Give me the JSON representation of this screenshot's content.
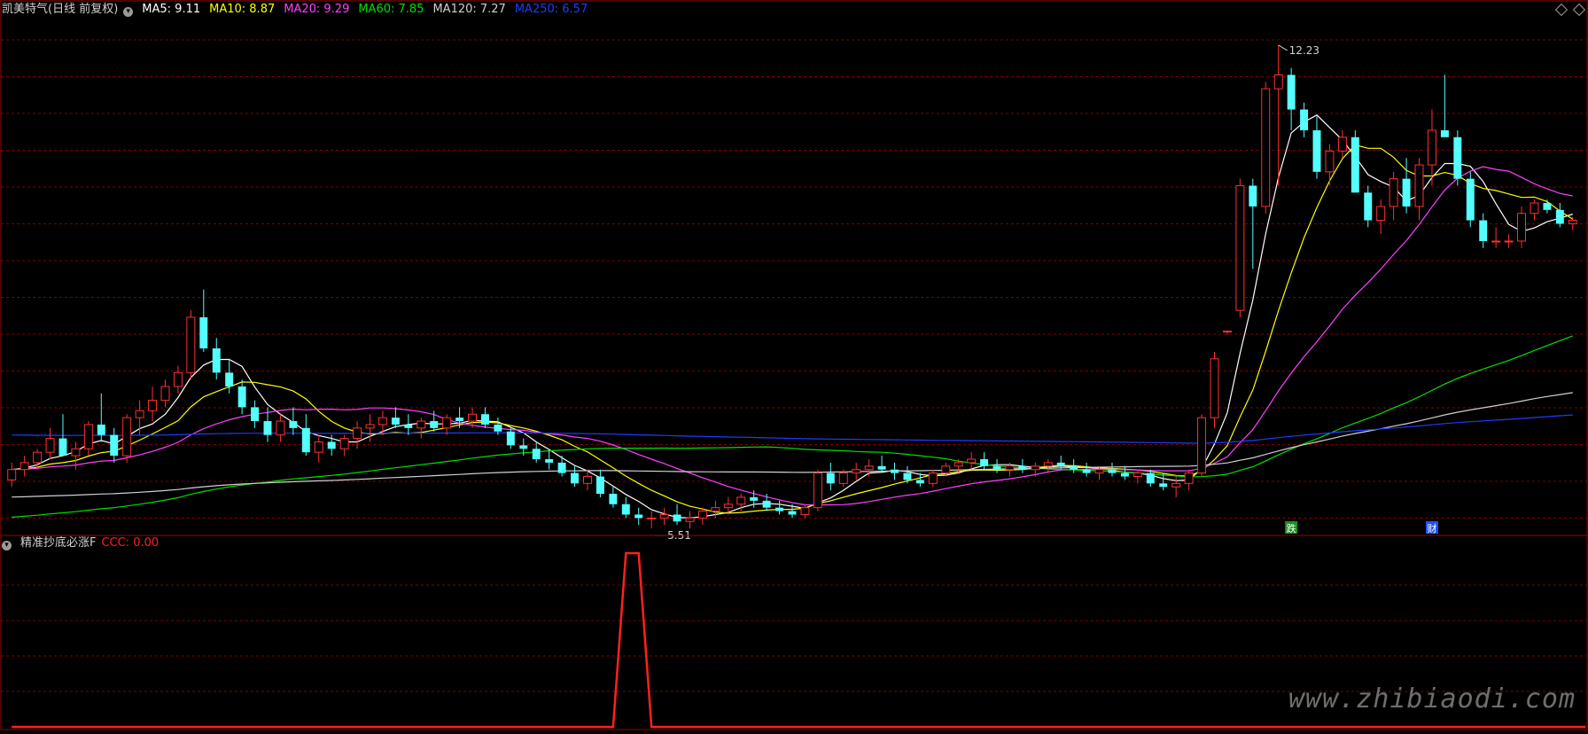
{
  "main_panel": {
    "stock_title": "凯美特气(日线 前复权)",
    "ma_legend": [
      {
        "label": "MA5: 9.11",
        "color": "#ffffff"
      },
      {
        "label": "MA10: 8.87",
        "color": "#ffff00"
      },
      {
        "label": "MA20: 9.29",
        "color": "#ff40ff"
      },
      {
        "label": "MA60: 7.85",
        "color": "#00e000"
      },
      {
        "label": "MA120: 7.27",
        "color": "#d0d0d0"
      },
      {
        "label": "MA250: 6.57",
        "color": "#1e3cff"
      }
    ],
    "high_annotation": "12.23",
    "low_annotation": "5.51",
    "event_markers": [
      "跌",
      "财"
    ]
  },
  "sub_panel": {
    "indicator_name": "精准抄底必涨F",
    "indicator_value": "CCC: 0.00",
    "indicator_color": "#ff2020"
  },
  "watermark": "www.zhibiaodi.com",
  "colors": {
    "up": "#ff3030",
    "down": "#54ffff",
    "grid": "#800000",
    "border": "#a00000",
    "ma5": "#ffffff",
    "ma10": "#ffff00",
    "ma20": "#ff40ff",
    "ma60": "#00e000",
    "ma120": "#d0d0d0",
    "ma250": "#1e3cff"
  },
  "chart_data": [
    {
      "type": "candlestick",
      "title": "凯美特气(日线 前复权)",
      "ylim": [
        5.2,
        12.6
      ],
      "candles": [
        [
          5.95,
          6.2,
          5.85,
          6.1
        ],
        [
          6.1,
          6.3,
          6.0,
          6.2
        ],
        [
          6.2,
          6.4,
          6.1,
          6.35
        ],
        [
          6.35,
          6.7,
          6.25,
          6.55
        ],
        [
          6.55,
          6.9,
          6.4,
          6.3
        ],
        [
          6.3,
          6.5,
          6.1,
          6.4
        ],
        [
          6.4,
          6.8,
          6.3,
          6.75
        ],
        [
          6.75,
          7.2,
          6.5,
          6.6
        ],
        [
          6.6,
          6.7,
          6.2,
          6.3
        ],
        [
          6.3,
          6.9,
          6.2,
          6.85
        ],
        [
          6.85,
          7.1,
          6.6,
          6.95
        ],
        [
          6.95,
          7.3,
          6.8,
          7.1
        ],
        [
          7.1,
          7.4,
          7.0,
          7.3
        ],
        [
          7.3,
          7.6,
          7.2,
          7.5
        ],
        [
          7.5,
          8.4,
          7.4,
          8.3
        ],
        [
          8.3,
          8.7,
          7.8,
          7.85
        ],
        [
          7.85,
          8.0,
          7.4,
          7.5
        ],
        [
          7.5,
          7.7,
          7.2,
          7.3
        ],
        [
          7.3,
          7.4,
          6.9,
          7.0
        ],
        [
          7.0,
          7.1,
          6.7,
          6.8
        ],
        [
          6.8,
          7.0,
          6.5,
          6.6
        ],
        [
          6.6,
          6.9,
          6.5,
          6.8
        ],
        [
          6.8,
          7.0,
          6.6,
          6.7
        ],
        [
          6.7,
          6.9,
          6.3,
          6.35
        ],
        [
          6.35,
          6.6,
          6.2,
          6.5
        ],
        [
          6.5,
          6.6,
          6.3,
          6.4
        ],
        [
          6.4,
          6.6,
          6.3,
          6.55
        ],
        [
          6.55,
          6.8,
          6.4,
          6.7
        ],
        [
          6.7,
          6.9,
          6.5,
          6.75
        ],
        [
          6.75,
          6.95,
          6.6,
          6.85
        ],
        [
          6.85,
          7.0,
          6.7,
          6.75
        ],
        [
          6.75,
          6.9,
          6.6,
          6.7
        ],
        [
          6.7,
          6.85,
          6.55,
          6.8
        ],
        [
          6.8,
          6.95,
          6.65,
          6.7
        ],
        [
          6.7,
          6.9,
          6.6,
          6.85
        ],
        [
          6.85,
          7.0,
          6.7,
          6.8
        ],
        [
          6.8,
          7.0,
          6.7,
          6.9
        ],
        [
          6.9,
          7.0,
          6.7,
          6.75
        ],
        [
          6.75,
          6.85,
          6.6,
          6.65
        ],
        [
          6.65,
          6.7,
          6.4,
          6.45
        ],
        [
          6.45,
          6.55,
          6.3,
          6.4
        ],
        [
          6.4,
          6.5,
          6.2,
          6.25
        ],
        [
          6.25,
          6.4,
          6.1,
          6.2
        ],
        [
          6.2,
          6.3,
          6.0,
          6.05
        ],
        [
          6.05,
          6.15,
          5.85,
          5.9
        ],
        [
          5.9,
          6.1,
          5.8,
          6.0
        ],
        [
          6.0,
          6.1,
          5.7,
          5.75
        ],
        [
          5.75,
          5.85,
          5.55,
          5.6
        ],
        [
          5.6,
          5.7,
          5.4,
          5.45
        ],
        [
          5.45,
          5.55,
          5.3,
          5.4
        ],
        [
          5.4,
          5.5,
          5.25,
          5.4
        ],
        [
          5.4,
          5.55,
          5.3,
          5.45
        ],
        [
          5.45,
          5.6,
          5.3,
          5.35
        ],
        [
          5.35,
          5.5,
          5.25,
          5.4
        ],
        [
          5.4,
          5.55,
          5.3,
          5.5
        ],
        [
          5.5,
          5.65,
          5.4,
          5.55
        ],
        [
          5.55,
          5.7,
          5.45,
          5.6
        ],
        [
          5.6,
          5.75,
          5.5,
          5.7
        ],
        [
          5.7,
          5.8,
          5.55,
          5.65
        ],
        [
          5.65,
          5.75,
          5.5,
          5.55
        ],
        [
          5.55,
          5.65,
          5.45,
          5.5
        ],
        [
          5.5,
          5.6,
          5.4,
          5.45
        ],
        [
          5.45,
          5.6,
          5.4,
          5.55
        ],
        [
          5.55,
          6.1,
          5.5,
          6.05
        ],
        [
          6.05,
          6.2,
          5.8,
          5.9
        ],
        [
          5.9,
          6.1,
          5.85,
          6.05
        ],
        [
          6.05,
          6.2,
          5.95,
          6.1
        ],
        [
          6.1,
          6.25,
          6.0,
          6.15
        ],
        [
          6.15,
          6.3,
          6.05,
          6.1
        ],
        [
          6.1,
          6.2,
          5.95,
          6.05
        ],
        [
          6.05,
          6.15,
          5.9,
          5.95
        ],
        [
          5.95,
          6.05,
          5.85,
          5.9
        ],
        [
          5.9,
          6.1,
          5.85,
          6.05
        ],
        [
          6.05,
          6.2,
          6.0,
          6.15
        ],
        [
          6.15,
          6.25,
          6.05,
          6.2
        ],
        [
          6.2,
          6.35,
          6.1,
          6.25
        ],
        [
          6.25,
          6.35,
          6.1,
          6.15
        ],
        [
          6.15,
          6.25,
          6.05,
          6.1
        ],
        [
          6.1,
          6.2,
          6.0,
          6.15
        ],
        [
          6.15,
          6.25,
          6.05,
          6.1
        ],
        [
          6.1,
          6.2,
          6.0,
          6.15
        ],
        [
          6.15,
          6.25,
          6.05,
          6.2
        ],
        [
          6.2,
          6.3,
          6.1,
          6.15
        ],
        [
          6.15,
          6.25,
          6.05,
          6.1
        ],
        [
          6.1,
          6.2,
          6.0,
          6.05
        ],
        [
          6.05,
          6.15,
          5.95,
          6.1
        ],
        [
          6.1,
          6.2,
          6.0,
          6.05
        ],
        [
          6.05,
          6.15,
          5.95,
          6.0
        ],
        [
          6.0,
          6.1,
          5.9,
          6.05
        ],
        [
          6.05,
          6.1,
          5.85,
          5.9
        ],
        [
          5.9,
          6.05,
          5.8,
          5.85
        ],
        [
          5.85,
          6.0,
          5.7,
          5.9
        ],
        [
          5.9,
          6.1,
          5.8,
          6.05
        ],
        [
          6.05,
          6.9,
          6.0,
          6.85
        ],
        [
          6.85,
          7.8,
          6.7,
          7.7
        ],
        [
          8.1,
          8.1,
          8.05,
          8.1
        ],
        [
          8.4,
          10.3,
          8.3,
          10.2
        ],
        [
          10.2,
          10.3,
          9.0,
          9.9
        ],
        [
          9.9,
          11.7,
          9.8,
          11.6
        ],
        [
          11.6,
          12.23,
          10.2,
          11.8
        ],
        [
          11.8,
          11.9,
          11.0,
          11.3
        ],
        [
          11.3,
          11.4,
          10.9,
          11.0
        ],
        [
          11.0,
          11.2,
          10.3,
          10.4
        ],
        [
          10.4,
          10.8,
          10.2,
          10.7
        ],
        [
          10.7,
          11.0,
          10.6,
          10.9
        ],
        [
          10.9,
          11.0,
          10.1,
          10.1
        ],
        [
          10.1,
          10.2,
          9.6,
          9.7
        ],
        [
          9.7,
          10.0,
          9.5,
          9.9
        ],
        [
          9.9,
          10.4,
          9.7,
          10.3
        ],
        [
          10.3,
          10.6,
          9.8,
          9.9
        ],
        [
          9.9,
          10.6,
          9.7,
          10.5
        ],
        [
          10.5,
          11.3,
          10.2,
          11.0
        ],
        [
          11.0,
          11.8,
          10.9,
          10.9
        ],
        [
          10.9,
          11.0,
          10.2,
          10.3
        ],
        [
          10.3,
          10.4,
          9.6,
          9.7
        ],
        [
          9.7,
          9.8,
          9.3,
          9.4
        ],
        [
          9.4,
          9.6,
          9.3,
          9.4
        ],
        [
          9.4,
          9.5,
          9.3,
          9.4
        ],
        [
          9.4,
          9.9,
          9.3,
          9.8
        ],
        [
          9.8,
          10.0,
          9.7,
          9.95
        ],
        [
          9.95,
          10.0,
          9.8,
          9.85
        ],
        [
          9.85,
          9.95,
          9.6,
          9.65
        ],
        [
          9.65,
          9.75,
          9.55,
          9.7
        ]
      ]
    },
    {
      "type": "line",
      "title": "精准抄底必涨F",
      "series": [
        {
          "name": "CCC",
          "values": [
            0,
            0,
            0,
            0,
            0,
            0,
            0,
            0,
            0,
            0,
            0,
            0,
            0,
            0,
            0,
            0,
            0,
            0,
            0,
            0,
            0,
            0,
            0,
            0,
            0,
            0,
            0,
            0,
            0,
            0,
            0,
            0,
            0,
            0,
            0,
            0,
            0,
            0,
            0,
            0,
            0,
            0,
            0,
            0,
            0,
            0,
            0,
            0,
            1,
            1,
            0,
            0,
            0,
            0,
            0,
            0,
            0,
            0,
            0,
            0,
            0,
            0,
            0,
            0,
            0,
            0,
            0,
            0,
            0,
            0,
            0,
            0,
            0,
            0,
            0,
            0,
            0,
            0,
            0,
            0,
            0,
            0,
            0,
            0,
            0,
            0,
            0,
            0,
            0,
            0,
            0,
            0,
            0,
            0,
            0,
            0,
            0,
            0,
            0,
            0,
            0,
            0,
            0,
            0,
            0,
            0,
            0,
            0,
            0,
            0,
            0,
            0,
            0,
            0,
            0,
            0,
            0,
            0,
            0,
            0,
            0,
            0,
            0,
            0
          ]
        }
      ]
    }
  ]
}
